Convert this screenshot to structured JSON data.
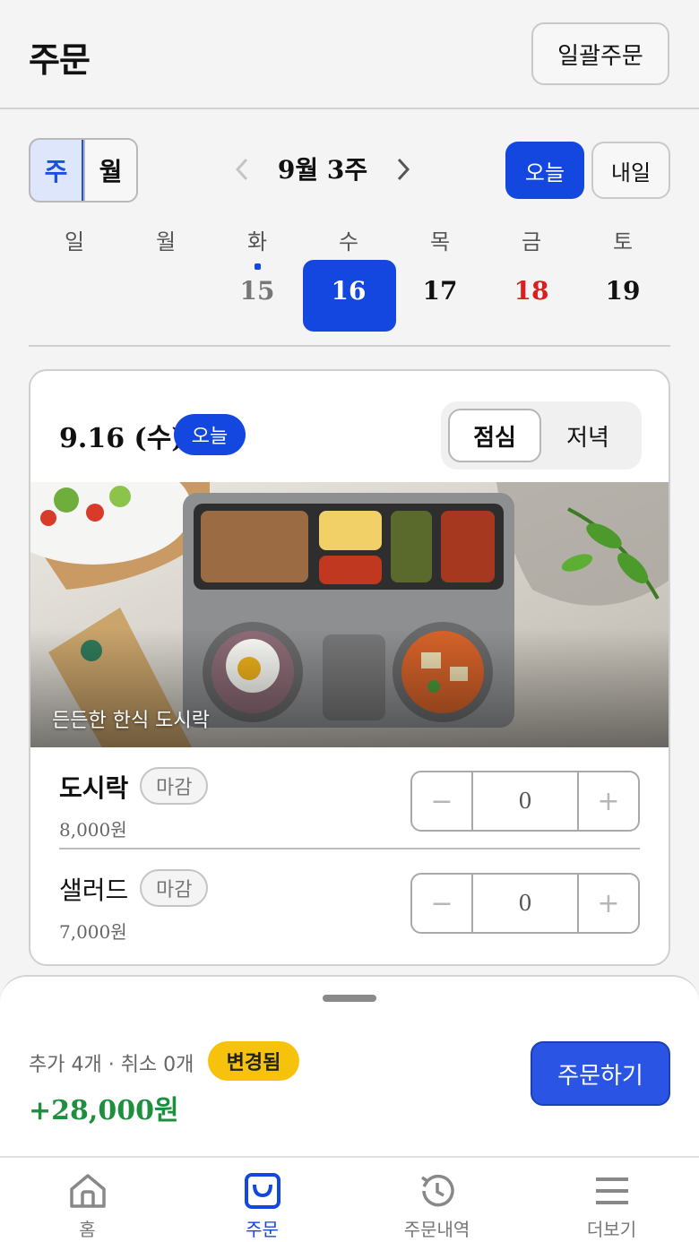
{
  "header": {
    "title": "주문",
    "bulk_order_label": "일괄주문"
  },
  "view_toggle": {
    "week_label": "주",
    "month_label": "월",
    "selected": "주"
  },
  "week_nav": {
    "label": "9월 3주"
  },
  "quick_buttons": {
    "today_label": "오늘",
    "tomorrow_label": "내일"
  },
  "week_days": [
    {
      "name": "일",
      "num": ""
    },
    {
      "name": "월",
      "num": ""
    },
    {
      "name": "화",
      "num": "15"
    },
    {
      "name": "수",
      "num": "16"
    },
    {
      "name": "목",
      "num": "17"
    },
    {
      "name": "금",
      "num": "18"
    },
    {
      "name": "토",
      "num": "19"
    }
  ],
  "card": {
    "date_label": "9.16 (수)",
    "today_badge": "오늘",
    "meal_lunch": "점심",
    "meal_dinner": "저녁",
    "photo_caption": "든든한 한식 도시락",
    "items": [
      {
        "name": "도시락",
        "badge": "마감",
        "price": "8,000원",
        "qty": "0"
      },
      {
        "name": "샐러드",
        "badge": "마감",
        "price": "7,000원",
        "qty": "0"
      }
    ],
    "stepper_minus": "−",
    "stepper_plus": "+"
  },
  "sheet": {
    "summary": "추가 4개 · 취소 0개",
    "changed_badge": "변경됨",
    "total": "+28,000원",
    "order_button": "주문하기"
  },
  "tabbar": [
    {
      "label": "홈",
      "icon": "home-icon"
    },
    {
      "label": "주문",
      "icon": "shopping-bag-icon"
    },
    {
      "label": "주문내역",
      "icon": "history-icon"
    },
    {
      "label": "더보기",
      "icon": "menu-icon"
    }
  ],
  "colors": {
    "accent": "#1447e0",
    "holiday": "#d91f1f",
    "total": "#1e8f3f",
    "badge": "#f7c20c"
  }
}
